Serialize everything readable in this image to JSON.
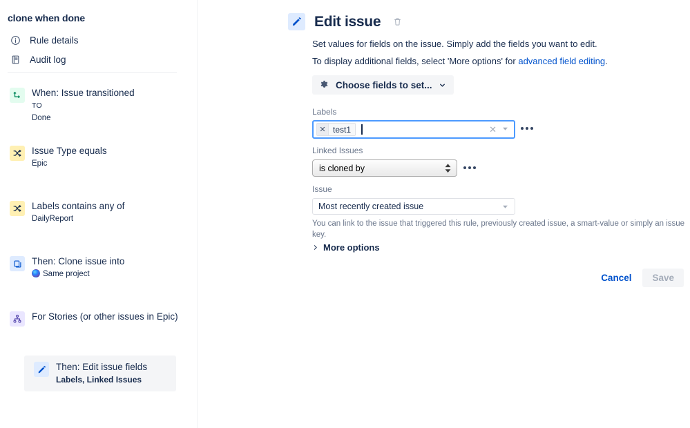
{
  "sidebar": {
    "rule_title": "clone when done",
    "nav": [
      {
        "label": "Rule details",
        "icon": "info-circle-icon"
      },
      {
        "label": "Audit log",
        "icon": "document-icon"
      }
    ],
    "steps": [
      {
        "title": "When: Issue transitioned",
        "sub1": "TO",
        "sub2": "Done",
        "icon": "transition-icon",
        "badge": "green"
      },
      {
        "title": "Issue Type equals",
        "sub1": "",
        "sub2": "Epic",
        "icon": "condition-icon",
        "badge": "yellow"
      },
      {
        "title": "Labels contains any of",
        "sub1": "",
        "sub2": "DailyReport",
        "icon": "condition-icon",
        "badge": "yellow"
      },
      {
        "title": "Then: Clone issue into",
        "sub1": "",
        "sub2": "Same project",
        "icon": "copy-icon",
        "badge": "blue"
      },
      {
        "title": "For Stories (or other issues in Epic)",
        "sub1": "",
        "sub2": "",
        "icon": "branch-icon",
        "badge": "purple"
      },
      {
        "title": "Then: Edit issue fields",
        "sub1": "",
        "sub2": "Labels, Linked Issues",
        "icon": "pencil-icon",
        "badge": "blue"
      }
    ]
  },
  "main": {
    "title": "Edit issue",
    "title_icon": "pencil-icon",
    "delete_icon": "trash-icon",
    "description_line1": "Set values for fields on the issue. Simply add the fields you want to edit.",
    "description_line2_prefix": "To display additional fields, select 'More options' for ",
    "description_link": "advanced field editing",
    "description_line2_suffix": ".",
    "choose_fields_label": "Choose fields to set...",
    "choose_fields_icon": "gear-icon",
    "fields": {
      "labels": {
        "label": "Labels",
        "tags": [
          "test1"
        ],
        "input_value": "",
        "placeholder": ""
      },
      "linked_issues": {
        "label": "Linked Issues",
        "value": "is cloned by"
      },
      "issue": {
        "label": "Issue",
        "value": "Most recently created issue",
        "hint": "You can link to the issue that triggered this rule, previously created issue, a smart-value or simply an issue key."
      }
    },
    "more_options_label": "More options",
    "cancel_label": "Cancel",
    "save_label": "Save"
  },
  "colors": {
    "accent_blue": "#0052CC",
    "focus_blue": "#4C9AFF",
    "text": "#172B4D",
    "subtle_text": "#6B778C",
    "badge_green_bg": "#E3FCEF",
    "badge_yellow_bg": "#FFF0B3",
    "badge_blue_bg": "#DEEBFF",
    "badge_purple_bg": "#EAE6FF",
    "selected_bg": "#F4F5F7"
  }
}
